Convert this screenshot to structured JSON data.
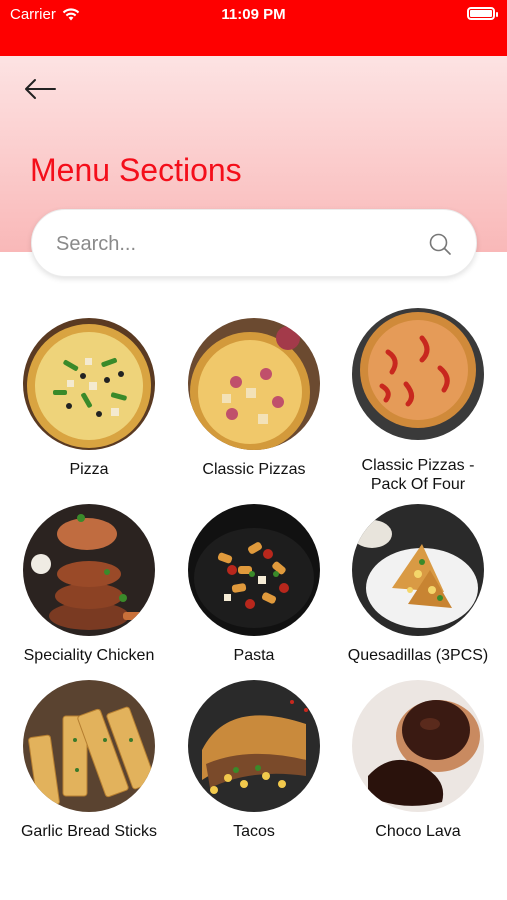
{
  "status_bar": {
    "carrier": "Carrier",
    "time": "11:09 PM"
  },
  "header": {
    "title": "Menu Sections"
  },
  "search": {
    "placeholder": "Search..."
  },
  "items": [
    {
      "label": "Pizza"
    },
    {
      "label": "Classic Pizzas"
    },
    {
      "label": "Classic Pizzas -\nPack Of Four"
    },
    {
      "label": "Speciality Chicken"
    },
    {
      "label": "Pasta"
    },
    {
      "label": "Quesadillas (3PCS)"
    },
    {
      "label": "Garlic Bread Sticks"
    },
    {
      "label": "Tacos"
    },
    {
      "label": "Choco Lava"
    }
  ],
  "colors": {
    "accent": "#fe0000",
    "title": "#f40e1a"
  }
}
